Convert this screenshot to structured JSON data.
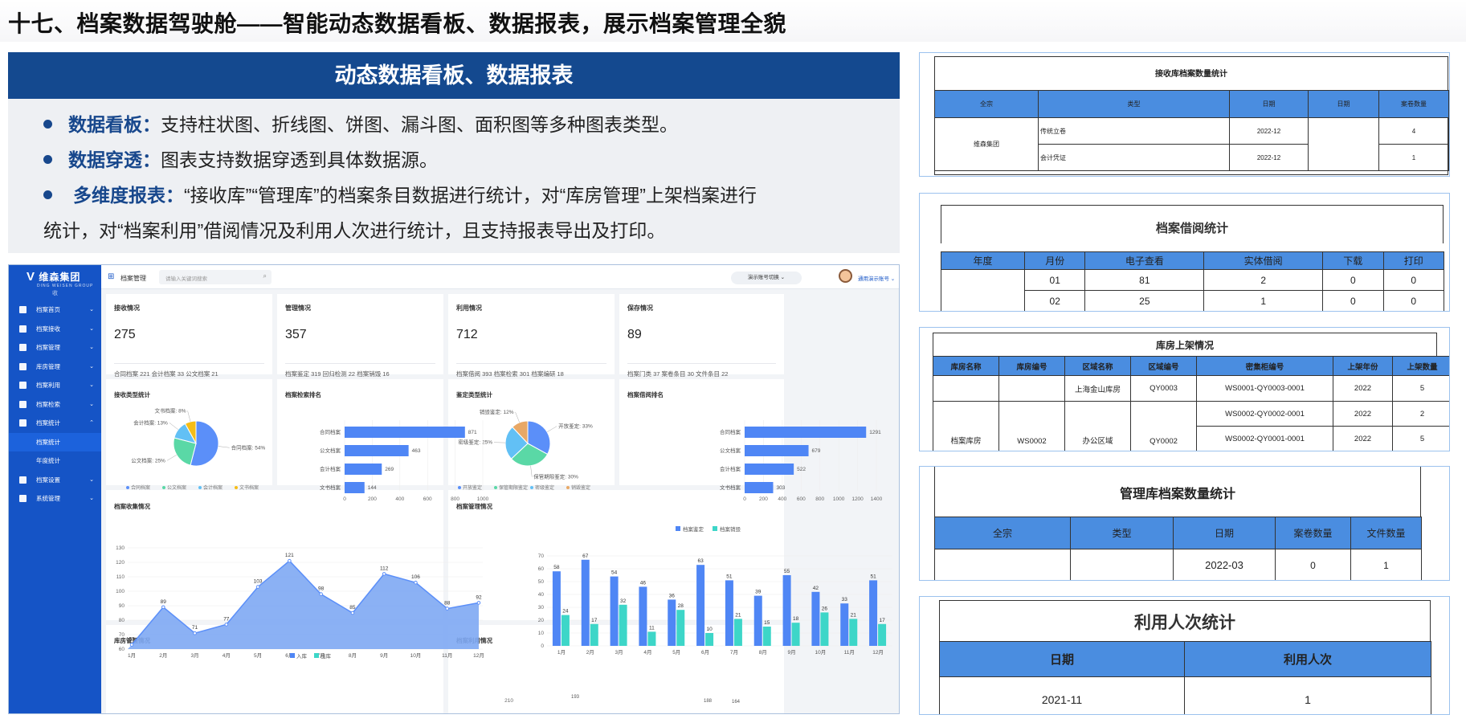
{
  "page_title": "十七、档案数据驾驶舱——智能动态数据看板、数据报表，展示档案管理全貌",
  "intro": {
    "heading": "动态数据看板、数据报表",
    "bullets": [
      {
        "term": "数据看板：",
        "text": "支持柱状图、折线图、饼图、漏斗图、面积图等多种图表类型。"
      },
      {
        "term": "数据穿透：",
        "text": "图表支持数据穿透到具体数据源。"
      },
      {
        "term": "多维度报表：",
        "text": "“接收库”“管理库”的档案条目数据进行统计，对“库房管理”上架档案进行",
        "text2": "统计，对“档案利用”借阅情况及利用人次进行统计，且支持报表导出及打印。"
      }
    ]
  },
  "app": {
    "brand": "维森集团",
    "brand_sub": "DING WEISEN GROUP",
    "collapse": "收",
    "menu": [
      {
        "label": "档案首页",
        "icon": "dashboard-icon"
      },
      {
        "label": "档案接收",
        "icon": "inbox-icon"
      },
      {
        "label": "档案管理",
        "icon": "layers-icon"
      },
      {
        "label": "库房管理",
        "icon": "box-icon"
      },
      {
        "label": "档案利用",
        "icon": "folder-icon"
      },
      {
        "label": "档案检索",
        "icon": "search-doc-icon"
      },
      {
        "label": "档案统计",
        "icon": "bar-chart-icon"
      },
      {
        "label": "档案统计",
        "icon": "",
        "sub": true,
        "active": true
      },
      {
        "label": "年度统计",
        "icon": "",
        "sub": true
      },
      {
        "label": "档案设置",
        "icon": "settings-doc-icon"
      },
      {
        "label": "系统管理",
        "icon": "gear-icon"
      }
    ],
    "header": {
      "section": "档案管理",
      "search_placeholder": "请输入关键词搜索",
      "switch_label": "演示账号切换",
      "user": "通用演示账号"
    },
    "stats": [
      {
        "title": "接收情况",
        "value": "275",
        "foot": "合同档案  221   会计档案  33   公文档案  21"
      },
      {
        "title": "管理情况",
        "value": "357",
        "foot": "档案鉴定  319   回归检测  22   档案销毁  16"
      },
      {
        "title": "利用情况",
        "value": "712",
        "foot": "档案借阅  393   档案检索  301   档案编研  18"
      },
      {
        "title": "保存情况",
        "value": "89",
        "foot": "档案门类  37   案卷条目  30   文件条目  22"
      }
    ],
    "titles": {
      "pie1": "接收类型统计",
      "rank1": "档案检索排名",
      "pie2": "鉴定类型统计",
      "rank2": "档案借阅排名",
      "area": "档案收集情况",
      "bars": "档案管理情况",
      "store": "库房管理情况",
      "use": "档案利用情况"
    },
    "store_legend": [
      "入库",
      "出库"
    ],
    "use_ticks": [
      "210",
      "193",
      "188",
      "164"
    ]
  },
  "chart_data": [
    {
      "type": "pie",
      "title": "接收类型统计",
      "categories": [
        "合同档案",
        "公文档案",
        "会计档案",
        "文书档案"
      ],
      "values": [
        54,
        25,
        13,
        8
      ],
      "colors": [
        "#5b8ff9",
        "#5ad8a6",
        "#62c0f5",
        "#f6bd16"
      ]
    },
    {
      "type": "bar",
      "orientation": "horizontal",
      "title": "档案检索排名",
      "categories": [
        "合同档案",
        "公文档案",
        "会计档案",
        "文书档案"
      ],
      "values": [
        871,
        463,
        269,
        144
      ],
      "xlim": [
        0,
        1000
      ],
      "ticks": [
        0,
        200,
        400,
        600,
        800,
        1000
      ]
    },
    {
      "type": "pie",
      "title": "鉴定类型统计",
      "categories": [
        "开放鉴定",
        "保管期限鉴定",
        "密级鉴定",
        "销毁鉴定"
      ],
      "values": [
        33,
        30,
        25,
        12
      ],
      "colors": [
        "#5b8ff9",
        "#5ad8a6",
        "#62c0f5",
        "#e8a866"
      ]
    },
    {
      "type": "bar",
      "orientation": "horizontal",
      "title": "档案借阅排名",
      "categories": [
        "合同档案",
        "公文档案",
        "会计档案",
        "文书档案"
      ],
      "values": [
        1291,
        679,
        522,
        303
      ],
      "xlim": [
        0,
        1400
      ],
      "ticks": [
        0,
        200,
        400,
        600,
        800,
        1000,
        1200,
        1400
      ]
    },
    {
      "type": "area",
      "title": "档案收集情况",
      "categories": [
        "1月",
        "2月",
        "3月",
        "4月",
        "5月",
        "6月",
        "7月",
        "8月",
        "9月",
        "10月",
        "11月",
        "12月"
      ],
      "values": [
        63,
        89,
        71,
        77,
        103,
        121,
        98,
        85,
        112,
        106,
        88,
        92
      ],
      "ylim": [
        60,
        130
      ],
      "ticks": [
        60,
        70,
        80,
        90,
        100,
        110,
        120,
        130
      ]
    },
    {
      "type": "bar",
      "title": "档案管理情况",
      "categories": [
        "1月",
        "2月",
        "3月",
        "4月",
        "5月",
        "6月",
        "7月",
        "8月",
        "9月",
        "10月",
        "11月",
        "12月"
      ],
      "series": [
        {
          "name": "档案鉴定",
          "values": [
            58,
            67,
            54,
            46,
            36,
            63,
            51,
            39,
            55,
            42,
            33,
            51
          ]
        },
        {
          "name": "档案销毁",
          "values": [
            24,
            17,
            32,
            11,
            28,
            10,
            21,
            15,
            18,
            26,
            21,
            17
          ]
        }
      ],
      "ylim": [
        0,
        70
      ],
      "ticks": [
        0,
        10,
        20,
        30,
        40,
        50,
        60,
        70
      ]
    }
  ],
  "reports": {
    "r1": {
      "title": "接收库档案数量统计",
      "headers": [
        "全宗",
        "类型",
        "日期",
        "日期",
        "案卷数量"
      ],
      "group": "维森集团",
      "rows": [
        [
          "传统立卷",
          "2022-12",
          "4"
        ],
        [
          "会计凭证",
          "2022-12",
          "1"
        ]
      ]
    },
    "r2": {
      "title": "档案借阅统计",
      "headers": [
        "年度",
        "月份",
        "电子查看",
        "实体借阅",
        "下载",
        "打印"
      ],
      "rows": [
        [
          "01",
          "81",
          "2",
          "0",
          "0"
        ],
        [
          "02",
          "25",
          "1",
          "0",
          "0"
        ]
      ]
    },
    "r3": {
      "title": "库房上架情况",
      "headers": [
        "库房名称",
        "库房编号",
        "区域名称",
        "区域编号",
        "密集柜编号",
        "上架年份",
        "上架数量"
      ],
      "row1": [
        "上海金山库房",
        "QY0003",
        "WS0001-QY0003-0001",
        "2022",
        "5"
      ],
      "name": "档案库房",
      "code": "WS0002",
      "area": "办公区域",
      "acode": "QY0002",
      "rows": [
        [
          "WS0002-QY0002-0001",
          "2022",
          "2"
        ],
        [
          "WS0002-QY0001-0001",
          "2022",
          "5"
        ]
      ]
    },
    "r4": {
      "title": "管理库档案数量统计",
      "headers": [
        "全宗",
        "类型",
        "日期",
        "案卷数量",
        "文件数量"
      ],
      "row": [
        "2022-03",
        "0",
        "1"
      ]
    },
    "r5": {
      "title": "利用人次统计",
      "headers": [
        "日期",
        "利用人次"
      ],
      "row": [
        "2021-11",
        "1"
      ]
    }
  }
}
